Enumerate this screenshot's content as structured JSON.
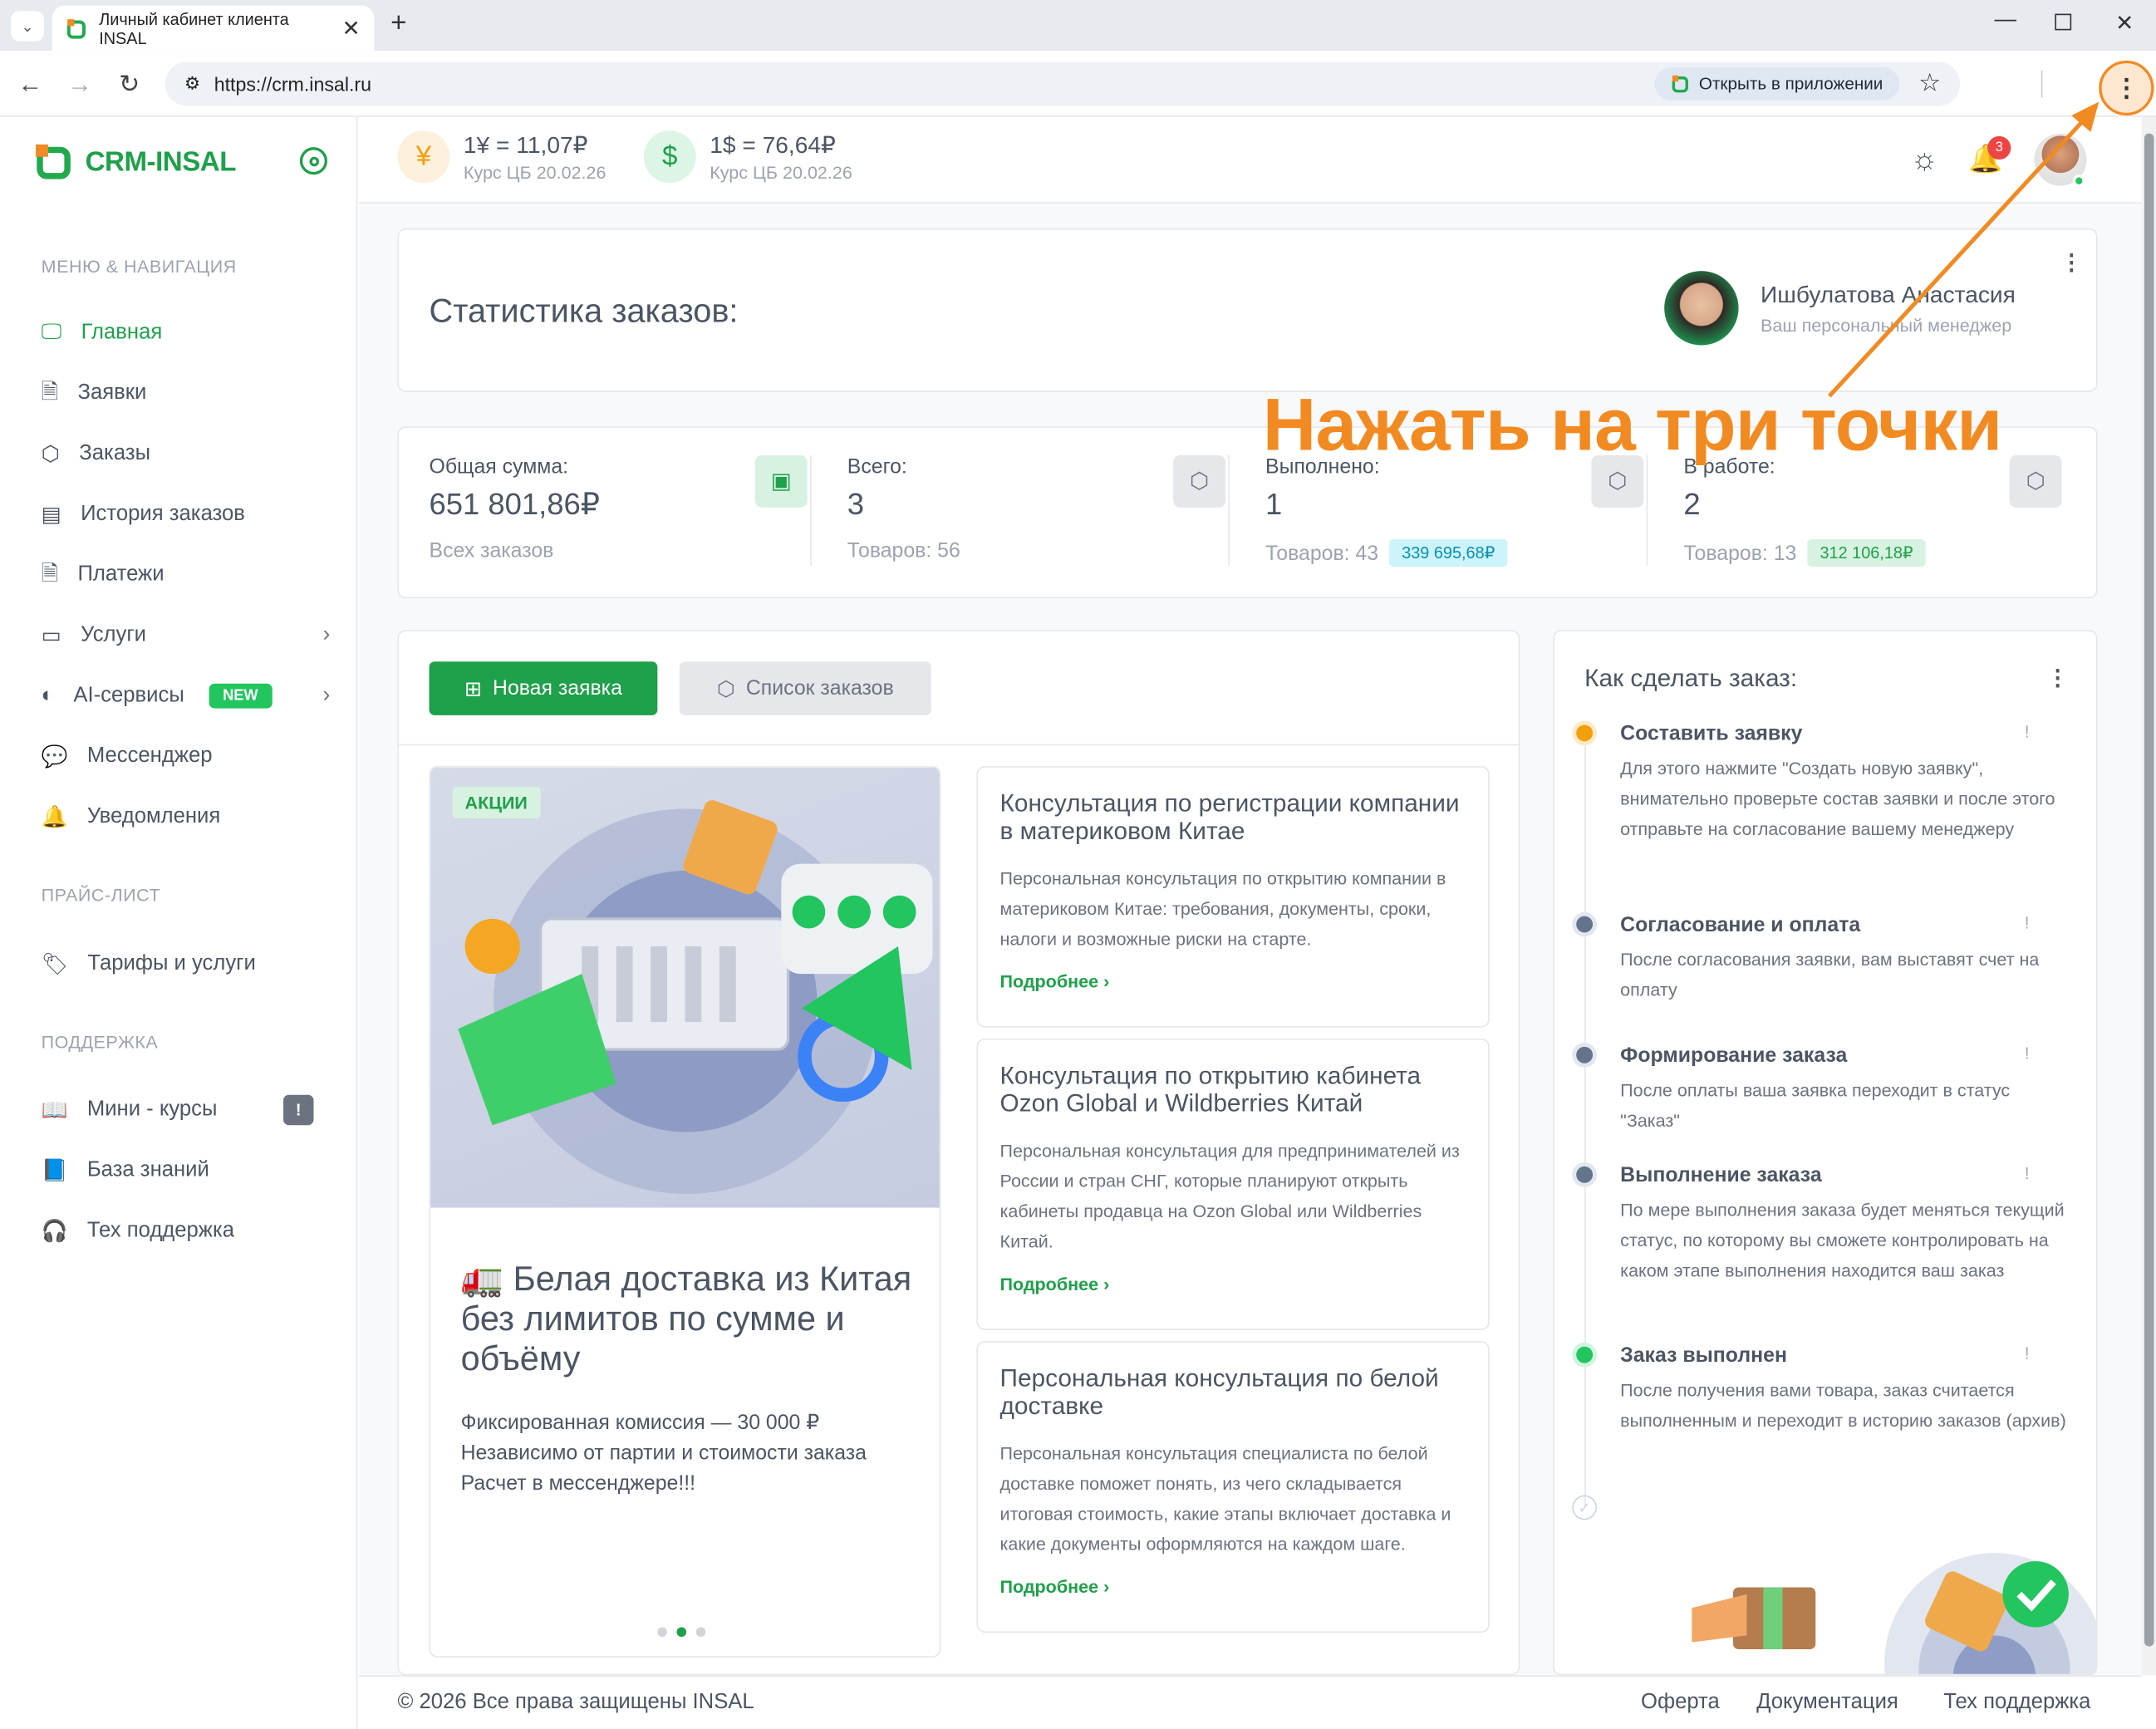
{
  "browser": {
    "tab_title": "Личный кабинет клиента INSAL",
    "url": "https://crm.insal.ru",
    "open_in_app": "Открыть в приложении"
  },
  "sidebar": {
    "brand": "CRM-INSAL",
    "sections": {
      "menu": "МЕНЮ & НАВИГАЦИЯ",
      "price": "ПРАЙС-ЛИСТ",
      "support": "ПОДДЕРЖКА"
    },
    "items": [
      {
        "label": "Главная"
      },
      {
        "label": "Заявки"
      },
      {
        "label": "Заказы"
      },
      {
        "label": "История заказов"
      },
      {
        "label": "Платежи"
      },
      {
        "label": "Услуги"
      },
      {
        "label": "AI-сервисы",
        "badge": "NEW"
      },
      {
        "label": "Мессенджер"
      },
      {
        "label": "Уведомления"
      },
      {
        "label": "Тарифы и услуги"
      },
      {
        "label": "Мини - курсы",
        "badge": "!"
      },
      {
        "label": "База знаний"
      },
      {
        "label": "Тех поддержка"
      }
    ]
  },
  "header": {
    "rates": [
      {
        "value": "1¥ = 11,07₽",
        "sub": "Курс ЦБ 20.02.26",
        "symbol": "¥"
      },
      {
        "value": "1$ = 76,64₽",
        "sub": "Курс ЦБ 20.02.26",
        "symbol": "$"
      }
    ],
    "notifications_count": "3"
  },
  "stats_card": {
    "title": "Статистика заказов:",
    "manager_name": "Ишбулатова Анастасия",
    "manager_role": "Ваш персональный менеджер"
  },
  "stats": [
    {
      "label": "Общая сумма:",
      "value": "651 801,86₽",
      "sub": "Всех заказов"
    },
    {
      "label": "Всего:",
      "value": "3",
      "sub": "Товаров: 56"
    },
    {
      "label": "Выполнено:",
      "value": "1",
      "sub": "Товаров: 43",
      "pill": "339 695,68₽"
    },
    {
      "label": "В работе:",
      "value": "2",
      "sub": "Товаров: 13",
      "pill": "312 106,18₽"
    }
  ],
  "actions": {
    "new_request": "Новая заявка",
    "orders_list": "Список заказов"
  },
  "promo": {
    "badge": "АКЦИИ",
    "title": "🚛 Белая доставка из Китая без лимитов по сумме и объёму",
    "lines": [
      "Фиксированная комиссия — 30 000 ₽",
      "Независимо от партии и стоимости заказа",
      "Расчет в мессенджере!!!"
    ]
  },
  "consultations": [
    {
      "title": "Консультация по регистрации компании в материковом Китае",
      "text": "Персональная консультация по открытию компании в материковом Китае: требования, документы, сроки, налоги и возможные риски на старте.",
      "more": "Подробнее"
    },
    {
      "title": "Консультация по открытию кабинета Ozon Global и Wildberries Китай",
      "text": "Персональная консультация для предпринимателей из России и стран СНГ, которые планируют открыть кабинеты продавца на Ozon Global или Wildberries Китай.",
      "more": "Подробнее"
    },
    {
      "title": "Персональная консультация по белой доставке",
      "text": "Персональная консультация специалиста по белой доставке поможет понять, из чего складывается итоговая стоимость, какие этапы включает доставка и какие документы оформляются на каждом шаге.",
      "more": "Подробнее"
    }
  ],
  "howto": {
    "title": "Как сделать заказ:",
    "steps": [
      {
        "title": "Составить заявку",
        "text": "Для этого нажмите \"Создать новую заявку\", внимательно проверьте состав заявки и после этого отправьте на согласование вашему менеджеру",
        "color": "#f59e0b"
      },
      {
        "title": "Согласование и оплата",
        "text": "После согласования заявки, вам выставят счет на оплату",
        "color": "#64748b"
      },
      {
        "title": "Формирование заказа",
        "text": "После оплаты ваша заявка переходит в статус \"Заказ\"",
        "color": "#64748b"
      },
      {
        "title": "Выполнение заказа",
        "text": "По мере выполнения заказа будет меняться текущий статус, по которому вы сможете контролировать на каком этапе выполнения находится ваш заказ",
        "color": "#64748b"
      },
      {
        "title": "Заказ выполнен",
        "text": "После получения вами товара, заказ считается выполненным и переходит в историю заказов (архив)",
        "color": "#22c55e"
      }
    ]
  },
  "footer": {
    "copyright": "© 2026 Все права защищены INSAL",
    "links": [
      "Оферта",
      "Документация",
      "Тех поддержка"
    ]
  },
  "annotation": "Нажать на три точки",
  "colors": {
    "brand_green": "#1fa04a",
    "annotation_orange": "#f28a22"
  }
}
